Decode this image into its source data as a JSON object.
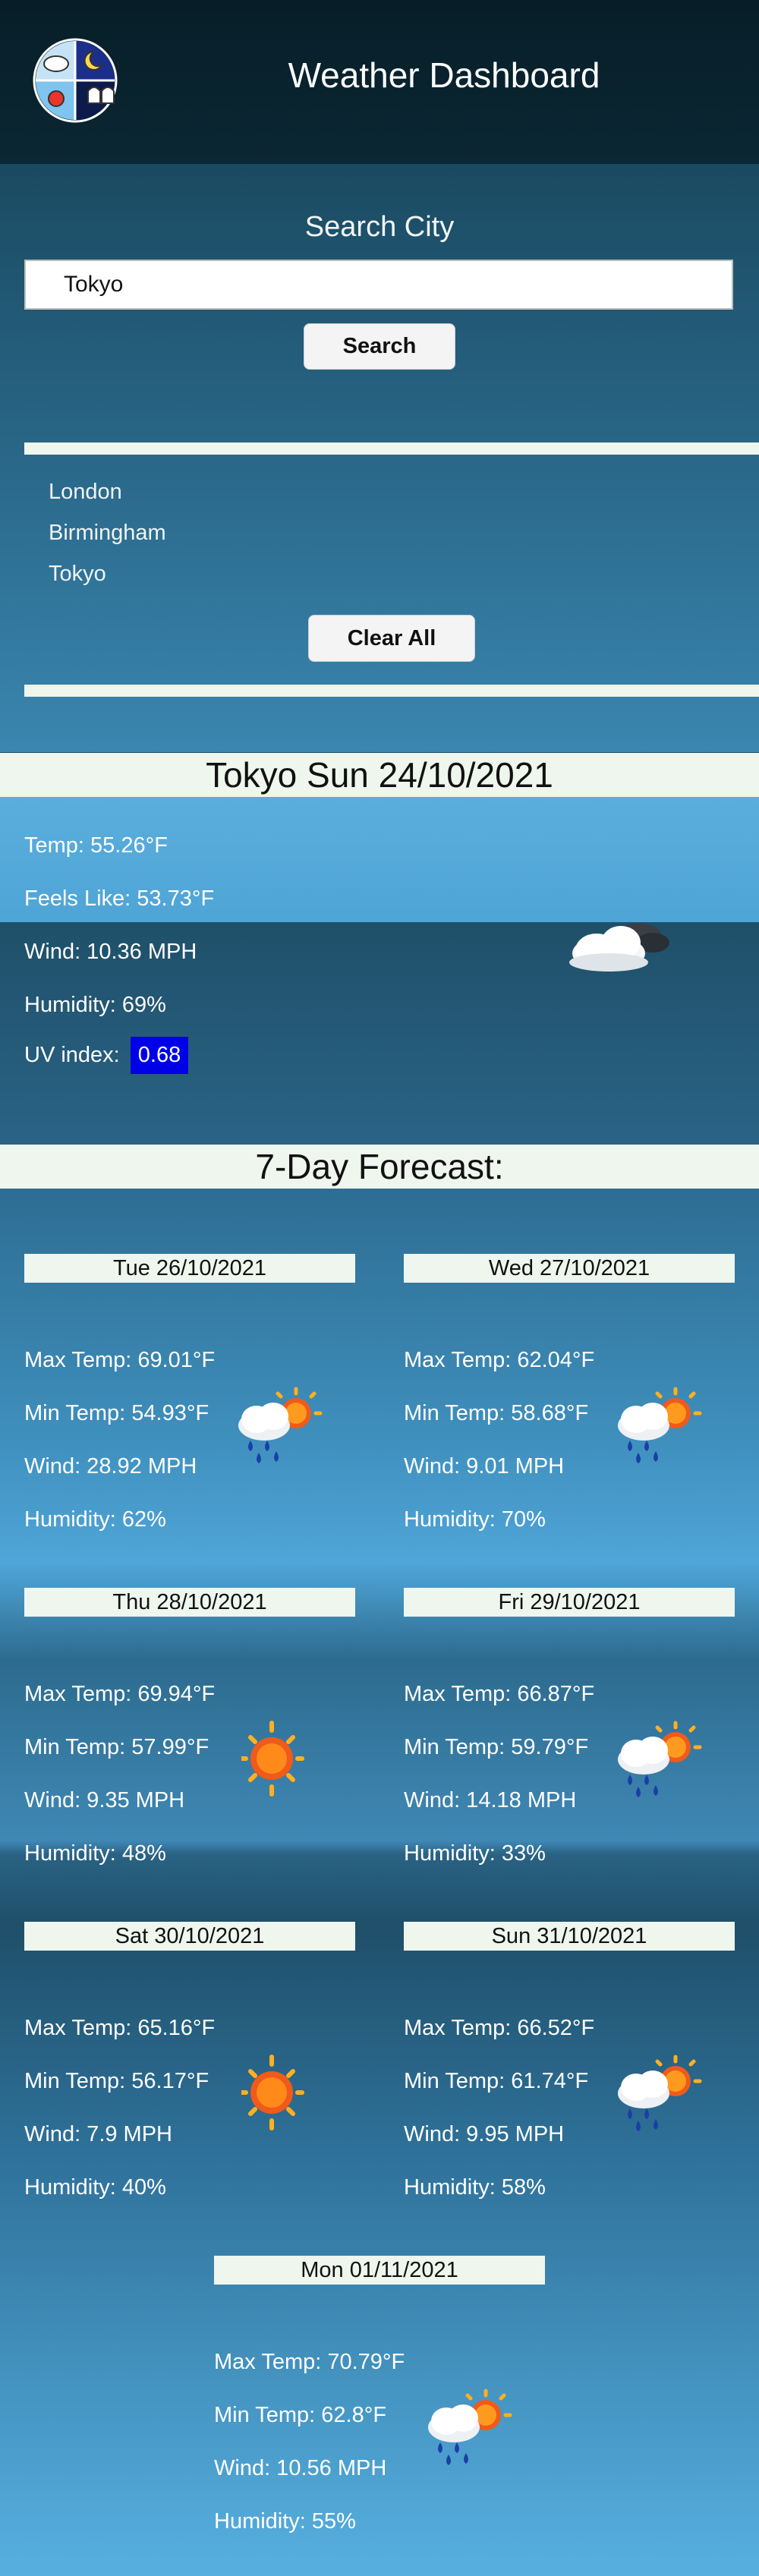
{
  "header": {
    "title": "Weather Dashboard",
    "logo_icon": "weather-logo-icon"
  },
  "search": {
    "title": "Search City",
    "input_value": "Tokyo",
    "button_label": "Search"
  },
  "history": {
    "items": [
      "London",
      "Birmingham",
      "Tokyo"
    ],
    "clear_label": "Clear All"
  },
  "current": {
    "heading": "Tokyo Sun 24/10/2021",
    "temp": "Temp: 55.26°F",
    "feels_like": "Feels Like: 53.73°F",
    "wind": "Wind: 10.36 MPH",
    "humidity": "Humidity: 69%",
    "uv_label": "UV index:",
    "uv_value": "0.68",
    "icon": "partly-cloudy-night-icon"
  },
  "forecast": {
    "heading": "7-Day Forecast:",
    "days": [
      {
        "date": "Tue 26/10/2021",
        "max": "Max Temp: 69.01°F",
        "min": "Min Temp: 54.93°F",
        "wind": "Wind: 28.92 MPH",
        "humidity": "Humidity: 62%",
        "icon": "rain-sun-icon"
      },
      {
        "date": "Wed 27/10/2021",
        "max": "Max Temp: 62.04°F",
        "min": "Min Temp: 58.68°F",
        "wind": "Wind: 9.01 MPH",
        "humidity": "Humidity: 70%",
        "icon": "rain-sun-icon"
      },
      {
        "date": "Thu 28/10/2021",
        "max": "Max Temp: 69.94°F",
        "min": "Min Temp: 57.99°F",
        "wind": "Wind: 9.35 MPH",
        "humidity": "Humidity: 48%",
        "icon": "sun-icon"
      },
      {
        "date": "Fri 29/10/2021",
        "max": "Max Temp: 66.87°F",
        "min": "Min Temp: 59.79°F",
        "wind": "Wind: 14.18 MPH",
        "humidity": "Humidity: 33%",
        "icon": "rain-sun-icon"
      },
      {
        "date": "Sat 30/10/2021",
        "max": "Max Temp: 65.16°F",
        "min": "Min Temp: 56.17°F",
        "wind": "Wind: 7.9 MPH",
        "humidity": "Humidity: 40%",
        "icon": "sun-icon"
      },
      {
        "date": "Sun 31/10/2021",
        "max": "Max Temp: 66.52°F",
        "min": "Min Temp: 61.74°F",
        "wind": "Wind: 9.95 MPH",
        "humidity": "Humidity: 58%",
        "icon": "rain-sun-icon"
      },
      {
        "date": "Mon 01/11/2021",
        "max": "Max Temp: 70.79°F",
        "min": "Min Temp: 62.8°F",
        "wind": "Wind: 10.56 MPH",
        "humidity": "Humidity: 55%",
        "icon": "rain-sun-icon"
      }
    ]
  },
  "colors": {
    "uv_badge": "#0000e8",
    "bar_bg": "#eef6ee",
    "header_bg": "#071e28"
  }
}
